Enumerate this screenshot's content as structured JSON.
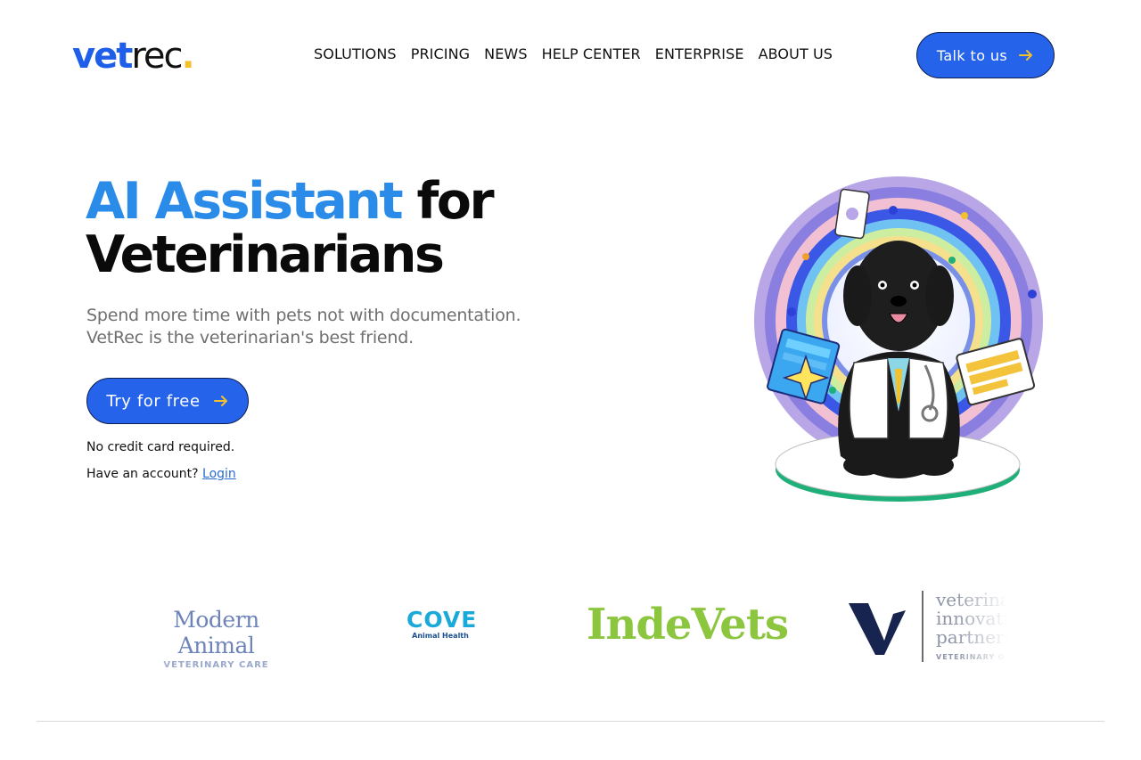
{
  "brand": {
    "logo_vet": "vet",
    "logo_rec": "rec",
    "logo_dot": "."
  },
  "nav": {
    "items": [
      "SOLUTIONS",
      "PRICING",
      "NEWS",
      "HELP CENTER",
      "ENTERPRISE",
      "ABOUT US"
    ],
    "cta_label": "Talk to us"
  },
  "hero": {
    "title_accent": "AI Assistant",
    "title_rest_1": " for",
    "title_line_2": "Veterinarians",
    "subtitle_line_1": "Spend more time with pets not with documentation.",
    "subtitle_line_2": "VetRec is the veterinarian's best friend.",
    "cta_label": "Try for free",
    "no_card_note": "No credit card required.",
    "account_prompt": "Have an account?",
    "login_link": "Login"
  },
  "partners": {
    "modern_animal_1": "Modern Animal",
    "modern_animal_2": "VETERINARY CARE",
    "cove_1": "COVE",
    "cove_2": "Animal Health",
    "indevets": "IndeVets",
    "vip_1": "veterinary",
    "vip_2": "innovation",
    "vip_3": "partners",
    "vip_small": "VETERINARY ONCOLOGY"
  },
  "colors": {
    "primary": "#2563eb",
    "accent_text": "#2a8ce8",
    "logo_yellow": "#f2c12e",
    "indevets_green": "#8cc63f"
  }
}
